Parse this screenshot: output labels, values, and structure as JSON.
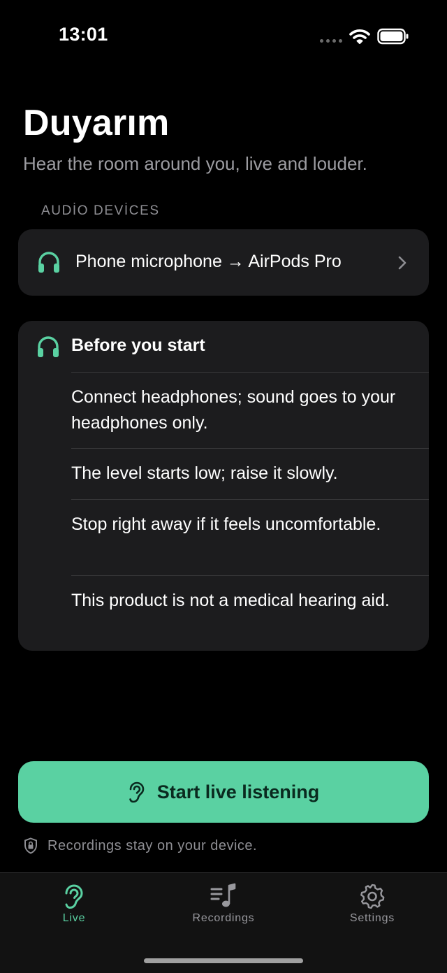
{
  "status_bar": {
    "time": "13:01",
    "wifi_icon": "wifi-icon",
    "battery_icon": "battery-icon"
  },
  "header": {
    "title": "Duyarım",
    "subtitle": "Hear the room around you, live and louder."
  },
  "audio_devices": {
    "section_title": "AUDİO DEVİCES",
    "route_label": "Phone microphone → AirPods Pro",
    "icon": "headphones-icon"
  },
  "before_start": {
    "title": "Before you start",
    "icon": "headphones-icon",
    "items": [
      "Connect headphones; sound goes to your headphones only.",
      "The level starts low; raise it slowly.",
      "Stop right away if it feels uncomfortable.",
      "This product is not a medical hearing aid."
    ]
  },
  "primary_action": {
    "label": "Start live listening",
    "icon": "ear-icon"
  },
  "privacy": {
    "text": "Recordings stay on your device.",
    "icon": "lock-shield-icon"
  },
  "tab_bar": {
    "tabs": [
      {
        "label": "Live",
        "icon": "ear-icon",
        "selected": true
      },
      {
        "label": "Recordings",
        "icon": "music-list-icon",
        "selected": false
      },
      {
        "label": "Settings",
        "icon": "gear-icon",
        "selected": false
      }
    ]
  },
  "colors": {
    "accent": "#5ad1a2",
    "background": "#000000",
    "card": "#1c1c1e",
    "secondary_text": "#8e8e93"
  }
}
